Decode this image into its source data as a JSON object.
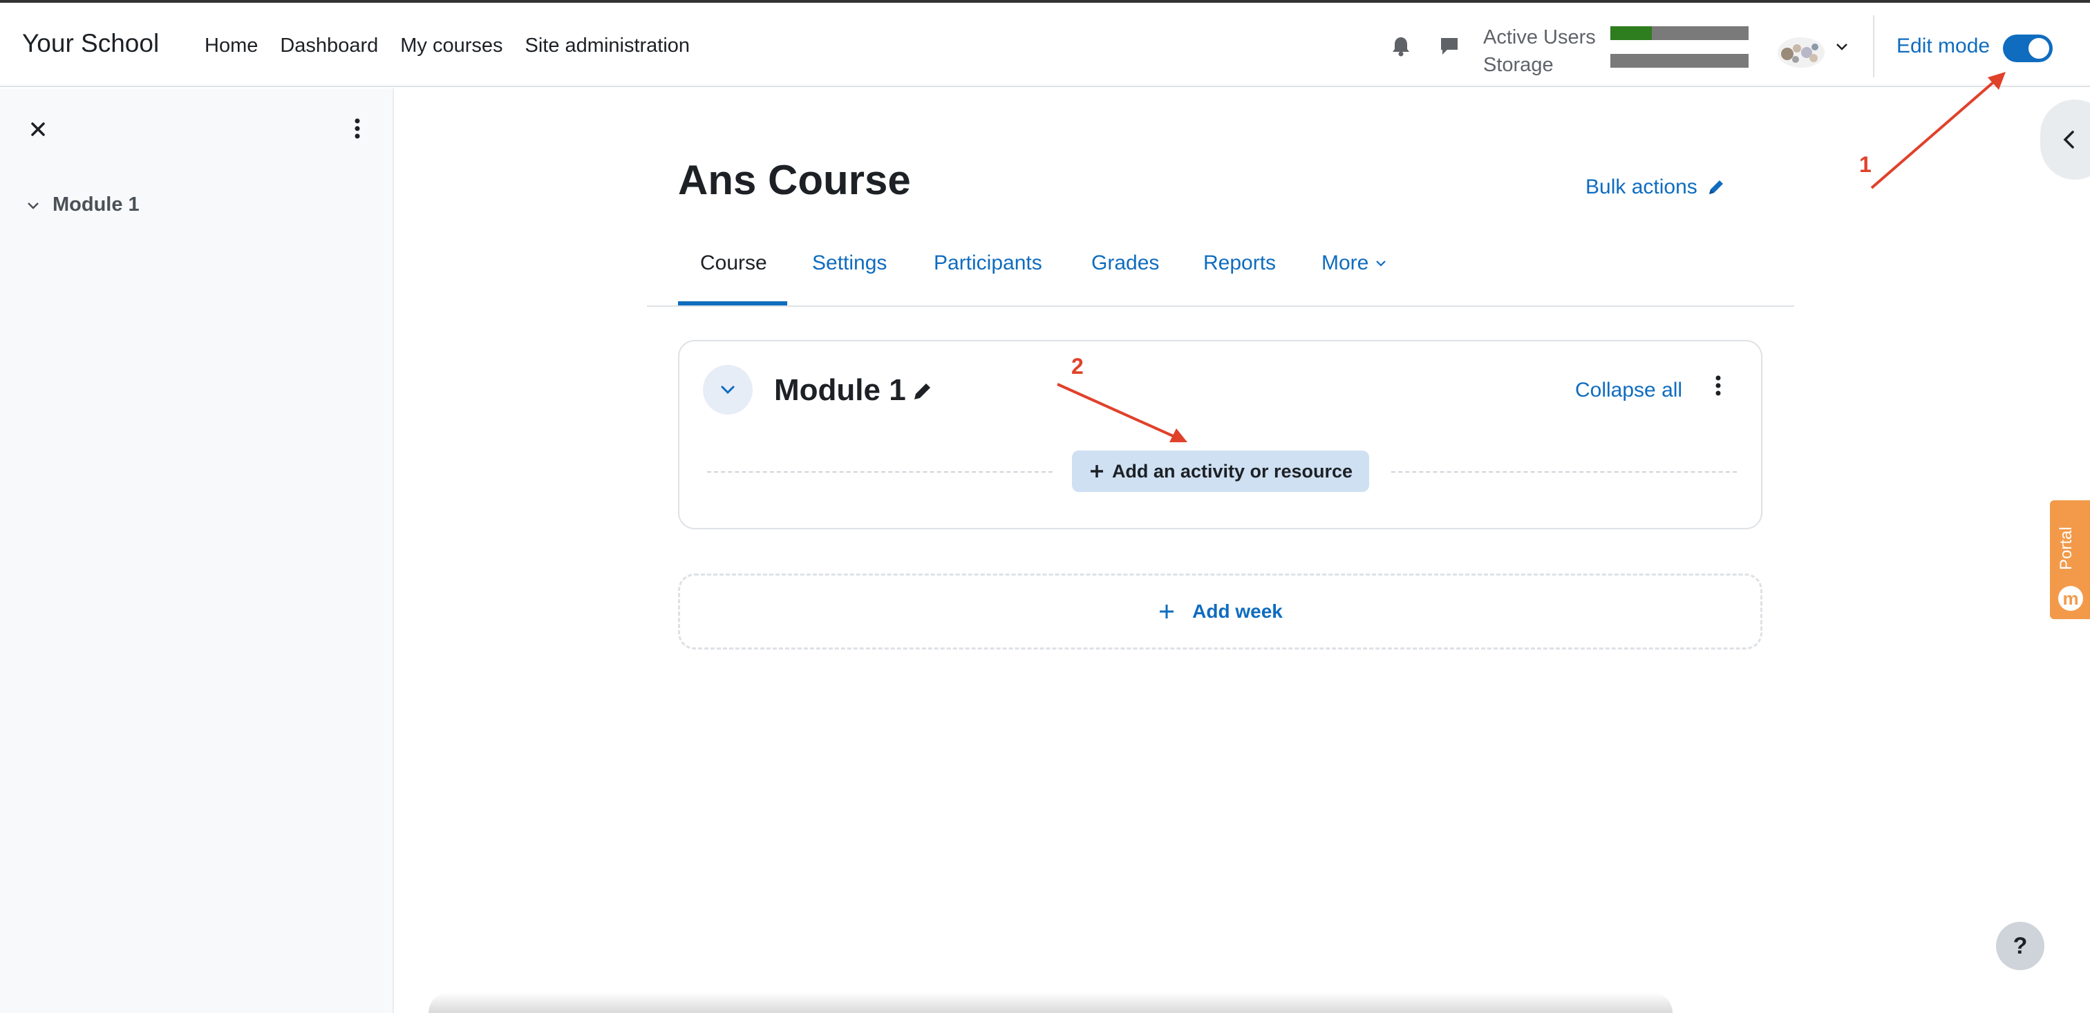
{
  "header": {
    "brand": "Your School",
    "nav": [
      "Home",
      "Dashboard",
      "My courses",
      "Site administration"
    ],
    "usage": {
      "active_users_label": "Active Users",
      "storage_label": "Storage",
      "active_users_fraction": 0.3,
      "storage_fraction": 0.0
    },
    "edit_mode_label": "Edit mode",
    "edit_mode_on": true,
    "colors": {
      "accent": "#0f6cbf",
      "usage_fill": "#2e7d1f",
      "usage_track": "#7a7a7a"
    }
  },
  "sidebar": {
    "items": [
      {
        "label": "Module 1"
      }
    ]
  },
  "course": {
    "title": "Ans Course",
    "bulk_actions": "Bulk actions",
    "tabs": [
      {
        "label": "Course",
        "active": true
      },
      {
        "label": "Settings"
      },
      {
        "label": "Participants"
      },
      {
        "label": "Grades"
      },
      {
        "label": "Reports"
      },
      {
        "label": "More"
      }
    ],
    "module": {
      "title": "Module 1",
      "collapse_all": "Collapse all",
      "add_activity": "Add an activity or resource"
    },
    "add_week": "Add week"
  },
  "annotations": {
    "marker_1": "1",
    "marker_2": "2",
    "color": "#e0412b"
  },
  "portal": {
    "label": "Portal",
    "logo": "m"
  },
  "help": {
    "label": "?"
  }
}
